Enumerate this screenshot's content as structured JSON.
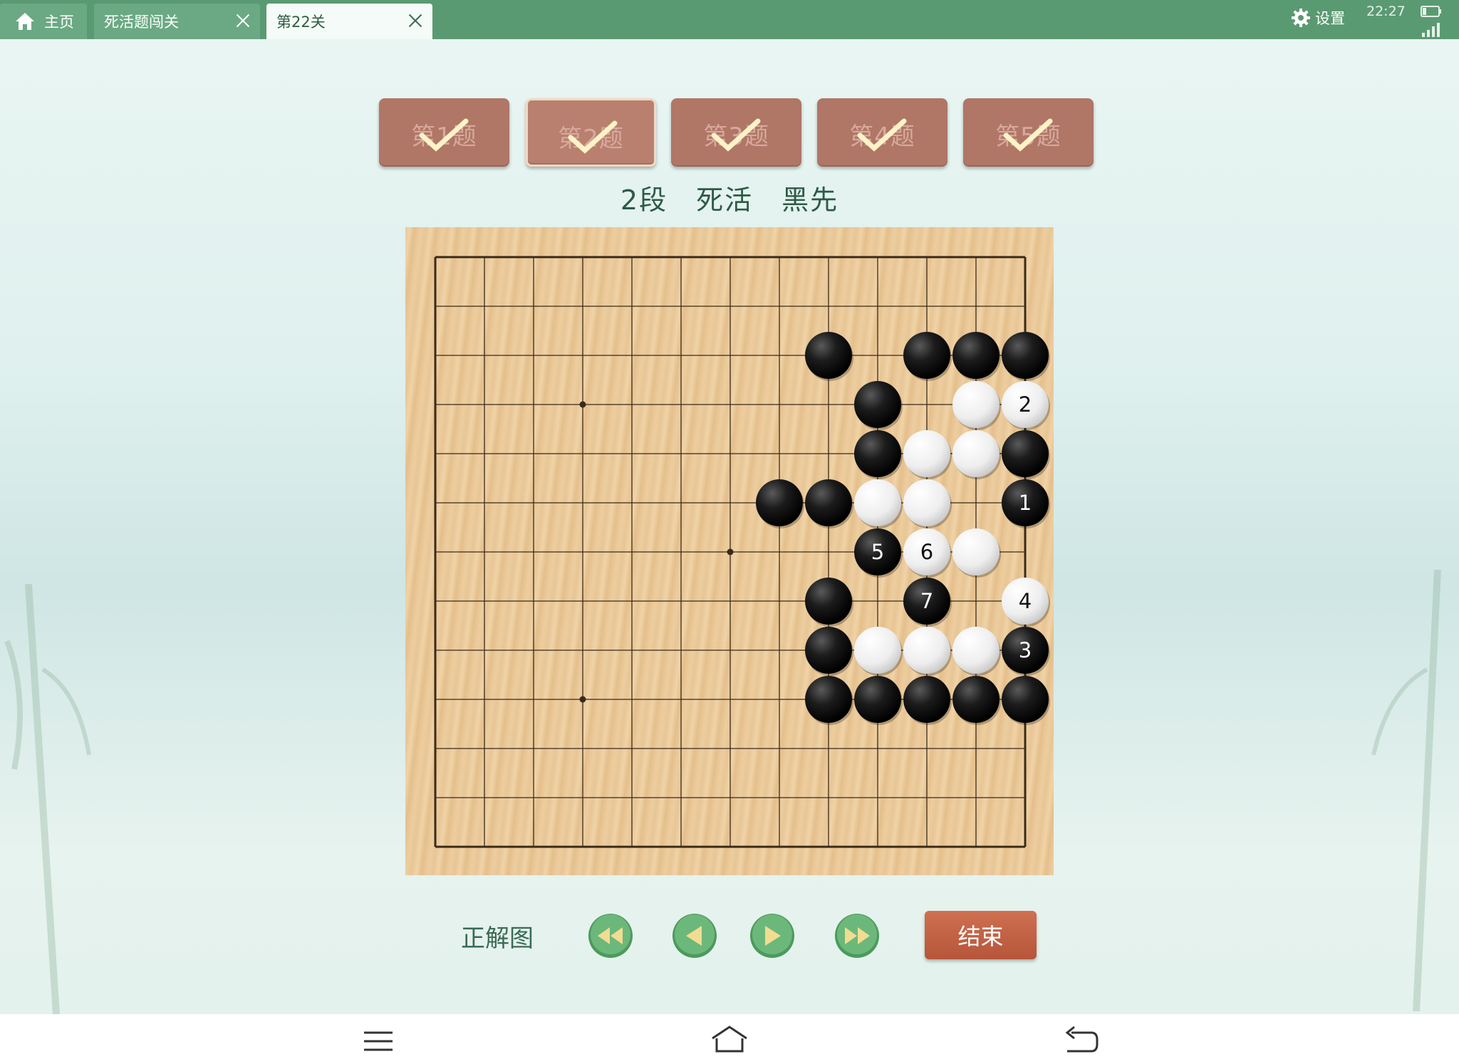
{
  "topbar": {
    "tabs": [
      {
        "label": "主页"
      },
      {
        "label": "死活题闯关"
      },
      {
        "label": "第22关"
      }
    ],
    "settings_label": "设置",
    "clock": "22:27"
  },
  "problems": [
    {
      "label": "第1题",
      "solved": true
    },
    {
      "label": "第2题",
      "solved": true,
      "selected": true
    },
    {
      "label": "第3题",
      "solved": true
    },
    {
      "label": "第4题",
      "solved": true
    },
    {
      "label": "第5题",
      "solved": true
    }
  ],
  "subtitle": "2段　死活　黑先",
  "board": {
    "size": 13,
    "star_points": [
      [
        3,
        3
      ],
      [
        6,
        6
      ],
      [
        3,
        9
      ]
    ],
    "stones": [
      {
        "c": "B",
        "col": 8,
        "row": 2
      },
      {
        "c": "B",
        "col": 10,
        "row": 2
      },
      {
        "c": "B",
        "col": 11,
        "row": 2
      },
      {
        "c": "B",
        "col": 12,
        "row": 2
      },
      {
        "c": "B",
        "col": 9,
        "row": 3
      },
      {
        "c": "W",
        "col": 11,
        "row": 3
      },
      {
        "c": "W",
        "col": 12,
        "row": 3,
        "n": "2"
      },
      {
        "c": "B",
        "col": 9,
        "row": 4
      },
      {
        "c": "W",
        "col": 10,
        "row": 4
      },
      {
        "c": "W",
        "col": 11,
        "row": 4
      },
      {
        "c": "B",
        "col": 12,
        "row": 4
      },
      {
        "c": "B",
        "col": 7,
        "row": 5
      },
      {
        "c": "B",
        "col": 8,
        "row": 5
      },
      {
        "c": "W",
        "col": 9,
        "row": 5
      },
      {
        "c": "W",
        "col": 10,
        "row": 5
      },
      {
        "c": "B",
        "col": 12,
        "row": 5,
        "n": "1"
      },
      {
        "c": "B",
        "col": 9,
        "row": 6,
        "n": "5"
      },
      {
        "c": "W",
        "col": 10,
        "row": 6,
        "n": "6"
      },
      {
        "c": "W",
        "col": 11,
        "row": 6
      },
      {
        "c": "B",
        "col": 8,
        "row": 7
      },
      {
        "c": "B",
        "col": 10,
        "row": 7,
        "n": "7"
      },
      {
        "c": "W",
        "col": 12,
        "row": 7,
        "n": "4"
      },
      {
        "c": "B",
        "col": 8,
        "row": 8
      },
      {
        "c": "W",
        "col": 9,
        "row": 8
      },
      {
        "c": "W",
        "col": 10,
        "row": 8
      },
      {
        "c": "W",
        "col": 11,
        "row": 8
      },
      {
        "c": "B",
        "col": 12,
        "row": 8,
        "n": "3"
      },
      {
        "c": "B",
        "col": 8,
        "row": 9
      },
      {
        "c": "B",
        "col": 9,
        "row": 9
      },
      {
        "c": "B",
        "col": 10,
        "row": 9
      },
      {
        "c": "B",
        "col": 11,
        "row": 9
      },
      {
        "c": "B",
        "col": 12,
        "row": 9
      }
    ]
  },
  "controls": {
    "answer_label": "正解图",
    "end_label": "结束"
  },
  "colors": {
    "topbar": "#5a9a72",
    "problem_button": "#b07666",
    "end_button": "#c4613f",
    "nav_button": "#4c9a5c"
  }
}
